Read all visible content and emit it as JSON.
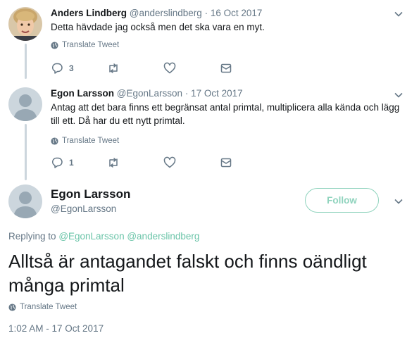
{
  "tweets": [
    {
      "name": "Anders Lindberg",
      "handle": "@anderslindberg",
      "date": "· 16 Oct 2017",
      "text": "Detta hävdade jag också men det ska vara en myt.",
      "translate": "Translate Tweet",
      "reply_count": "3"
    },
    {
      "name": "Egon Larsson",
      "handle": "@EgonLarsson",
      "date": "· 17 Oct 2017",
      "text": "Antag att det bara finns ett begränsat antal primtal, multiplicera alla kända och lägg till ett. Då har du ett nytt primtal.",
      "translate": "Translate Tweet",
      "reply_count": "1"
    }
  ],
  "main": {
    "name": "Egon Larsson",
    "handle": "@EgonLarsson",
    "follow_label": "Follow",
    "replying_prefix": "Replying to",
    "replying_to_1": "@EgonLarsson",
    "replying_to_2": "@anderslindberg",
    "text": "Alltså är antagandet falskt och finns oändligt många primtal",
    "translate": "Translate Tweet",
    "timestamp": "1:02 AM - 17 Oct 2017"
  },
  "colors": {
    "accent": "#8fd3bd",
    "link": "#6ac4a8",
    "muted": "#657786",
    "text": "#14171a",
    "thread_line": "#ccd6dd"
  },
  "icons": {
    "reply": "reply-icon",
    "retweet": "retweet-icon",
    "like": "heart-icon",
    "message": "envelope-icon",
    "translate": "globe-icon",
    "menu": "chevron-down-icon"
  }
}
